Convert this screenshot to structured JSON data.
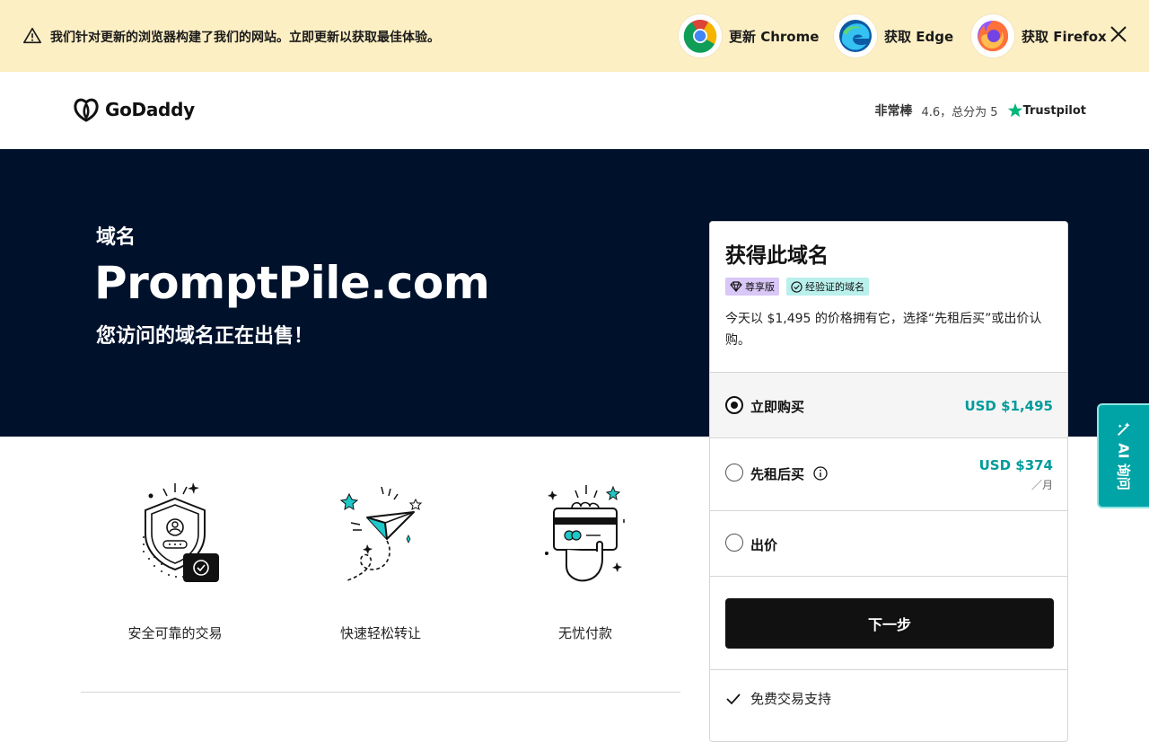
{
  "banner": {
    "message": "我们针对更新的浏览器构建了我们的网站。立即更新以获取最佳体验。",
    "browsers": [
      {
        "name": "chrome-icon",
        "label": "更新 Chrome"
      },
      {
        "name": "edge-icon",
        "label": "获取 Edge"
      },
      {
        "name": "firefox-icon",
        "label": "获取 Firefox"
      }
    ]
  },
  "header": {
    "brand": "GoDaddy",
    "rating_word": "非常棒",
    "rating_text": "4.6，总分为 5",
    "trustpilot": "Trustpilot"
  },
  "hero": {
    "kicker": "域名",
    "domain": "PromptPile.com",
    "subtitle": "您访问的域名正在出售！"
  },
  "features": [
    {
      "label": "安全可靠的交易"
    },
    {
      "label": "快速轻松转让"
    },
    {
      "label": "无忧付款"
    }
  ],
  "card": {
    "title": "获得此域名",
    "badge_premium": "尊享版",
    "badge_verified": "经验证的域名",
    "description": "今天以 $1,495 的价格拥有它，选择“先租后买”或出价认购。",
    "options": {
      "buy_now": {
        "label": "立即购买",
        "price": "USD $1,495"
      },
      "lease": {
        "label": "先租后买",
        "price": "USD $374",
        "per": "／月"
      },
      "offer": {
        "label": "出价"
      }
    },
    "next_button": "下一步",
    "support": "免费交易支持"
  },
  "ai_tab": {
    "label": "AI 询问"
  },
  "colors": {
    "hero_bg": "#00112c",
    "banner_bg": "#fdefc4",
    "accent_teal": "#009b9b",
    "ai_tab": "#00a4a6"
  }
}
